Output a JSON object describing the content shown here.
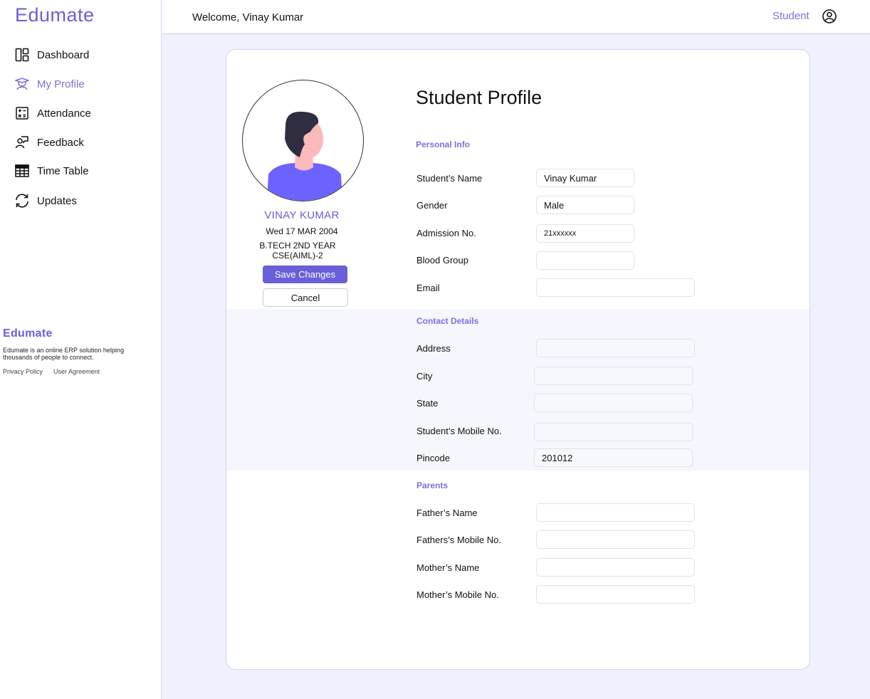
{
  "app": {
    "brand": "Edumate"
  },
  "sidebar": {
    "items": [
      {
        "label": "Dashboard",
        "icon": "dashboard-icon",
        "active": false
      },
      {
        "label": "My Profile",
        "icon": "graduate-icon",
        "active": true
      },
      {
        "label": "Attendance",
        "icon": "calculator-icon",
        "active": false
      },
      {
        "label": "Feedback",
        "icon": "feedback-icon",
        "active": false
      },
      {
        "label": "Time Table",
        "icon": "table-icon",
        "active": false
      },
      {
        "label": "Updates",
        "icon": "refresh-icon",
        "active": false
      }
    ],
    "footer": {
      "brand": "Edumate",
      "description": "Edumate is an online ERP solution helping thousands of people to connect.",
      "privacy": "Privacy Policy",
      "agreement": "User Agreement"
    }
  },
  "header": {
    "welcome": "Welcome, Vinay Kumar",
    "role": "Student",
    "user_icon": "user-circle-icon"
  },
  "profile": {
    "name": "VINAY KUMAR",
    "dob": "Wed 17 MAR 2004",
    "course_line1": "B.TECH 2ND YEAR",
    "course_line2": "CSE(AIML)-2",
    "save_label": "Save Changes",
    "cancel_label": "Cancel"
  },
  "form": {
    "title": "Student Profile",
    "personal": {
      "heading": "Personal Info",
      "fields": [
        {
          "label": "Student’s Name",
          "value": "Vinay Kumar"
        },
        {
          "label": "Gender",
          "value": "Male"
        },
        {
          "label": "Admission No.",
          "value": "21xxxxxx"
        },
        {
          "label": "Blood Group",
          "value": ""
        },
        {
          "label": "Email",
          "value": ""
        }
      ]
    },
    "contact": {
      "heading": "Contact Details",
      "fields": [
        {
          "label": "Address",
          "value": ""
        },
        {
          "label": "City",
          "value": ""
        },
        {
          "label": "State",
          "value": ""
        },
        {
          "label": "Student’s Mobile No.",
          "value": ""
        },
        {
          "label": "Pincode",
          "value": "201012"
        }
      ]
    },
    "parents": {
      "heading": "Parents",
      "fields": [
        {
          "label": "Father’s Name",
          "value": ""
        },
        {
          "label": "Fathers’s Mobile No.",
          "value": ""
        },
        {
          "label": "Mother’s Name",
          "value": ""
        },
        {
          "label": "Mother’s Mobile No.",
          "value": ""
        }
      ]
    }
  },
  "colors": {
    "accent": "#6a5fd8",
    "accent_light": "#7b70dc",
    "page_bg": "#eff1ff",
    "band_bg": "#f5f6fe"
  }
}
